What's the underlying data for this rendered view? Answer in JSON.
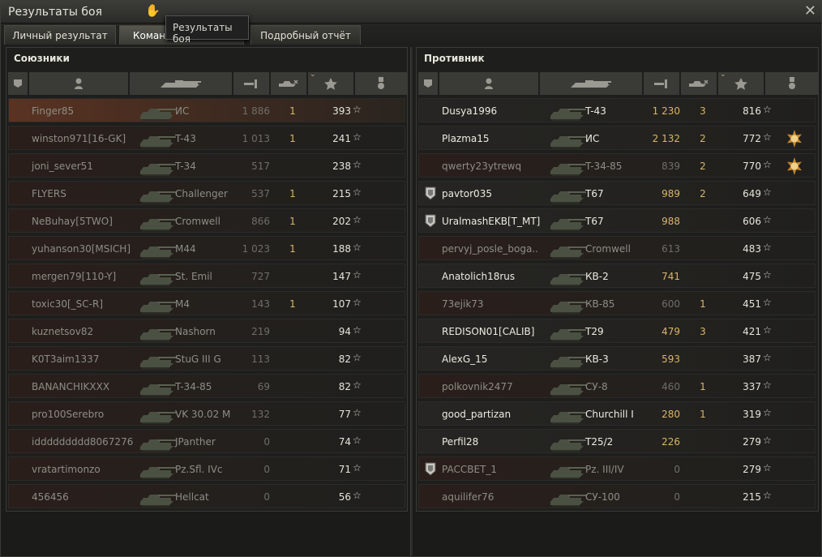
{
  "window": {
    "title": "Результаты боя",
    "close_label": "✕"
  },
  "tooltip": "Результаты боя",
  "tabs": [
    {
      "label": "Личный результат"
    },
    {
      "label": "Команд"
    },
    {
      "label": "Подробный отчёт"
    }
  ],
  "left": {
    "title": "Союзники",
    "rows": [
      {
        "name": "Finger85",
        "tank": "ИС",
        "damage": "1 886",
        "kills": "1",
        "xp": "393"
      },
      {
        "name": "winston971[16-GK]",
        "tank": "T-43",
        "damage": "1 013",
        "kills": "1",
        "xp": "241"
      },
      {
        "name": "joni_sever51",
        "tank": "T-34",
        "damage": "517",
        "kills": "",
        "xp": "238"
      },
      {
        "name": "FLYERS",
        "tank": "Challenger",
        "damage": "537",
        "kills": "1",
        "xp": "215"
      },
      {
        "name": "NeBuhay[5TWO]",
        "tank": "Cromwell",
        "damage": "866",
        "kills": "1",
        "xp": "202"
      },
      {
        "name": "yuhanson30[MSICH]",
        "tank": "M44",
        "damage": "1 023",
        "kills": "1",
        "xp": "188"
      },
      {
        "name": "mergen79[110-Y]",
        "tank": "St. Emil",
        "damage": "727",
        "kills": "",
        "xp": "147"
      },
      {
        "name": "toxic30[_SC-R]",
        "tank": "M4",
        "damage": "143",
        "kills": "1",
        "xp": "107"
      },
      {
        "name": "kuznetsov82",
        "tank": "Nashorn",
        "damage": "219",
        "kills": "",
        "xp": "94"
      },
      {
        "name": "K0T3aim1337",
        "tank": "StuG III G",
        "damage": "113",
        "kills": "",
        "xp": "82"
      },
      {
        "name": "BANANCHIKXXX",
        "tank": "T-34-85",
        "damage": "69",
        "kills": "",
        "xp": "82"
      },
      {
        "name": "pro100Serebro",
        "tank": "VK 30.02 M",
        "damage": "132",
        "kills": "",
        "xp": "77"
      },
      {
        "name": "iddddddddd8067276",
        "tank": "JPanther",
        "damage": "0",
        "kills": "",
        "xp": "74"
      },
      {
        "name": "vratartimonzo",
        "tank": "Pz.Sfl. IVc",
        "damage": "0",
        "kills": "",
        "xp": "71"
      },
      {
        "name": "456456",
        "tank": "Hellcat",
        "damage": "0",
        "kills": "",
        "xp": "56"
      }
    ]
  },
  "right": {
    "title": "Противник",
    "rows": [
      {
        "name": "Dusya1996",
        "tank": "T-43",
        "damage": "1 230",
        "kills": "3",
        "xp": "816",
        "alive": true
      },
      {
        "name": "Plazma15",
        "tank": "ИС",
        "damage": "2 132",
        "kills": "2",
        "xp": "772",
        "alive": true,
        "medal": true
      },
      {
        "name": "qwerty23ytrewq",
        "tank": "T-34-85",
        "damage": "839",
        "kills": "2",
        "xp": "770",
        "alive": false,
        "medal": true
      },
      {
        "name": "pavtor035",
        "tank": "T67",
        "damage": "989",
        "kills": "2",
        "xp": "649",
        "alive": true,
        "badge": true
      },
      {
        "name": "UralmashEKB[T_MT]",
        "tank": "T67",
        "damage": "988",
        "kills": "",
        "xp": "606",
        "alive": true,
        "badge": true
      },
      {
        "name": "pervyj_posle_boga..",
        "tank": "Cromwell",
        "damage": "613",
        "kills": "",
        "xp": "483",
        "alive": false
      },
      {
        "name": "Anatolich18rus",
        "tank": "КВ-2",
        "damage": "741",
        "kills": "",
        "xp": "475",
        "alive": true
      },
      {
        "name": "73ejik73",
        "tank": "КВ-85",
        "damage": "600",
        "kills": "1",
        "xp": "451",
        "alive": false
      },
      {
        "name": "REDISON01[CALIB]",
        "tank": "T29",
        "damage": "479",
        "kills": "3",
        "xp": "421",
        "alive": true
      },
      {
        "name": "AlexG_15",
        "tank": "КВ-3",
        "damage": "593",
        "kills": "",
        "xp": "387",
        "alive": true
      },
      {
        "name": "polkovnik2477",
        "tank": "СУ-8",
        "damage": "460",
        "kills": "1",
        "xp": "337",
        "alive": false
      },
      {
        "name": "good_partizan",
        "tank": "Churchill I",
        "damage": "280",
        "kills": "1",
        "xp": "319",
        "alive": true
      },
      {
        "name": "Perfil28",
        "tank": "T25/2",
        "damage": "226",
        "kills": "",
        "xp": "279",
        "alive": true
      },
      {
        "name": "PACCBET_1",
        "tank": "Pz. III/IV",
        "damage": "0",
        "kills": "",
        "xp": "279",
        "alive": false,
        "badge": true
      },
      {
        "name": "aquilifer76",
        "tank": "СУ-100",
        "damage": "0",
        "kills": "",
        "xp": "215",
        "alive": false
      }
    ]
  },
  "icons": {
    "rank": "badge-icon",
    "player": "player-icon",
    "tank": "tank-icon",
    "damage": "damage-icon",
    "kills": "kills-icon",
    "xp": "star-icon",
    "medal": "medal-icon"
  },
  "colors": {
    "accent": "#d9b56a",
    "self_row": "#5a3322",
    "alive_text": "#ecece2",
    "dead_text": "#8d8d85"
  }
}
